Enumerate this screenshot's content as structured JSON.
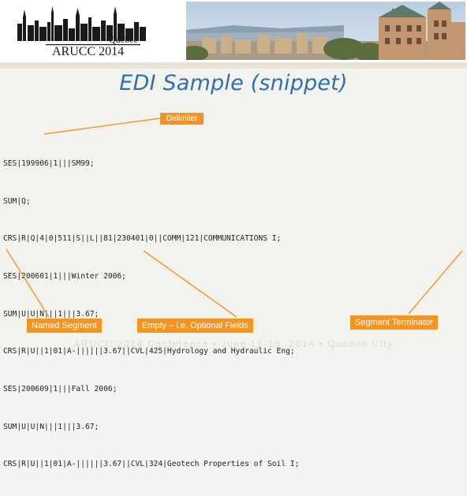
{
  "header": {
    "logo_text": "ARUCC 2014",
    "logo_city": "Quebec"
  },
  "slide": {
    "title": "EDI Sample (snippet)"
  },
  "code_lines": [
    "SES|199906|1|||SM99;",
    "SUM|Q;",
    "CRS|R|Q|4|0|511|S||L||81|230401|0||COMM|121|COMMUNICATIONS I;",
    "SES|200601|1|||Winter 2006;",
    "SUM|U|U|N|||1|||3.67;",
    "CRS|R|U||1|01|A-||||||3.67||CVL|425|Hydrology and Hydraulic Eng;",
    "SES|200609|1|||Fall 2006;",
    "SUM|U|U|N|||1|||3.67;",
    "CRS|R|U||1|01|A-||||||3.67||CVL|324|Geotech Properties of Soil I;"
  ],
  "annotations": {
    "delimiter": "Delimiter",
    "named_segment": "Named Segment",
    "empty_fields": "Empty – i.e. Optional Fields",
    "segment_terminator": "Segment Terminator"
  },
  "footer": {
    "text": "ARUCC 2014 Conference • June 15-18, 2014 • Quebec City"
  },
  "colors": {
    "title": "#2e6fb0",
    "annotation": "#f7941d"
  }
}
